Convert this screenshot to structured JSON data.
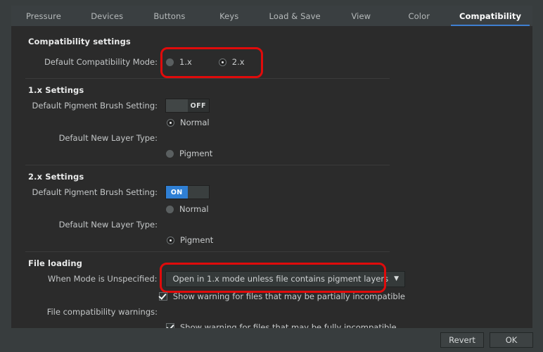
{
  "window": {
    "accent_color": "#3f7fd0",
    "highlight_color": "#e00b0b",
    "background": "#2b2b2b"
  },
  "tabs": [
    {
      "label": "Pressure",
      "active": false
    },
    {
      "label": "Devices",
      "active": false
    },
    {
      "label": "Buttons",
      "active": false
    },
    {
      "label": "Keys",
      "active": false
    },
    {
      "label": "Load & Save",
      "active": false
    },
    {
      "label": "View",
      "active": false
    },
    {
      "label": "Color",
      "active": false
    },
    {
      "label": "Compatibility",
      "active": true
    }
  ],
  "sections": {
    "compatibility_settings": {
      "heading": "Compatibility settings",
      "default_mode": {
        "label": "Default Compatibility Mode:",
        "options": [
          {
            "label": "1.x",
            "selected": false
          },
          {
            "label": "2.x",
            "selected": true
          }
        ],
        "selected_value": "2.x"
      }
    },
    "one_x_settings": {
      "heading": "1.x Settings",
      "pigment_brush": {
        "label": "Default Pigment Brush Setting:",
        "state": "OFF",
        "on_label": "ON",
        "off_label": "OFF"
      },
      "new_layer_type": {
        "label": "Default New Layer Type:",
        "options": [
          {
            "label": "Normal",
            "selected": true
          },
          {
            "label": "Pigment",
            "selected": false
          }
        ],
        "selected_value": "Normal"
      }
    },
    "two_x_settings": {
      "heading": "2.x Settings",
      "pigment_brush": {
        "label": "Default Pigment Brush Setting:",
        "state": "ON",
        "on_label": "ON",
        "off_label": "OFF"
      },
      "new_layer_type": {
        "label": "Default New Layer Type:",
        "options": [
          {
            "label": "Normal",
            "selected": false
          },
          {
            "label": "Pigment",
            "selected": true
          }
        ],
        "selected_value": "Pigment"
      }
    },
    "file_loading": {
      "heading": "File loading",
      "mode_unspecified": {
        "label": "When Mode is Unspecified:",
        "selected_value": "Open in 1.x mode unless file contains pigment layers",
        "caret_icon": "chevron-down-icon"
      },
      "compat_warnings": {
        "label": "File compatibility warnings:",
        "items": [
          {
            "label": "Show warning for files that may be partially incompatible",
            "checked": true
          },
          {
            "label": "Show warning for files that may be fully incompatible",
            "checked": true
          }
        ]
      }
    }
  },
  "footer": {
    "revert_label": "Revert",
    "ok_label": "OK"
  }
}
